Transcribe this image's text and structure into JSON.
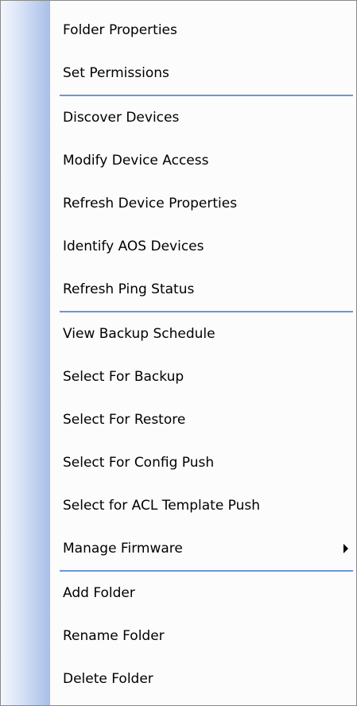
{
  "menu": {
    "items": [
      {
        "label": "Folder Properties"
      },
      {
        "label": "Set Permissions"
      },
      {
        "label": "Discover Devices"
      },
      {
        "label": "Modify Device Access"
      },
      {
        "label": "Refresh Device Properties"
      },
      {
        "label": "Identify AOS Devices"
      },
      {
        "label": "Refresh Ping Status"
      },
      {
        "label": "View Backup Schedule"
      },
      {
        "label": "Select For Backup"
      },
      {
        "label": "Select For Restore"
      },
      {
        "label": "Select For Config Push"
      },
      {
        "label": "Select for ACL Template Push"
      },
      {
        "label": "Manage Firmware",
        "submenu_icon": "submenu-arrow-icon"
      },
      {
        "label": "Add Folder"
      },
      {
        "label": "Rename Folder"
      },
      {
        "label": "Delete Folder"
      }
    ]
  },
  "colors": {
    "separator": "#6d95d8",
    "gutter_dark": "#a9bfe9",
    "gutter_light": "#f2f6fd"
  }
}
